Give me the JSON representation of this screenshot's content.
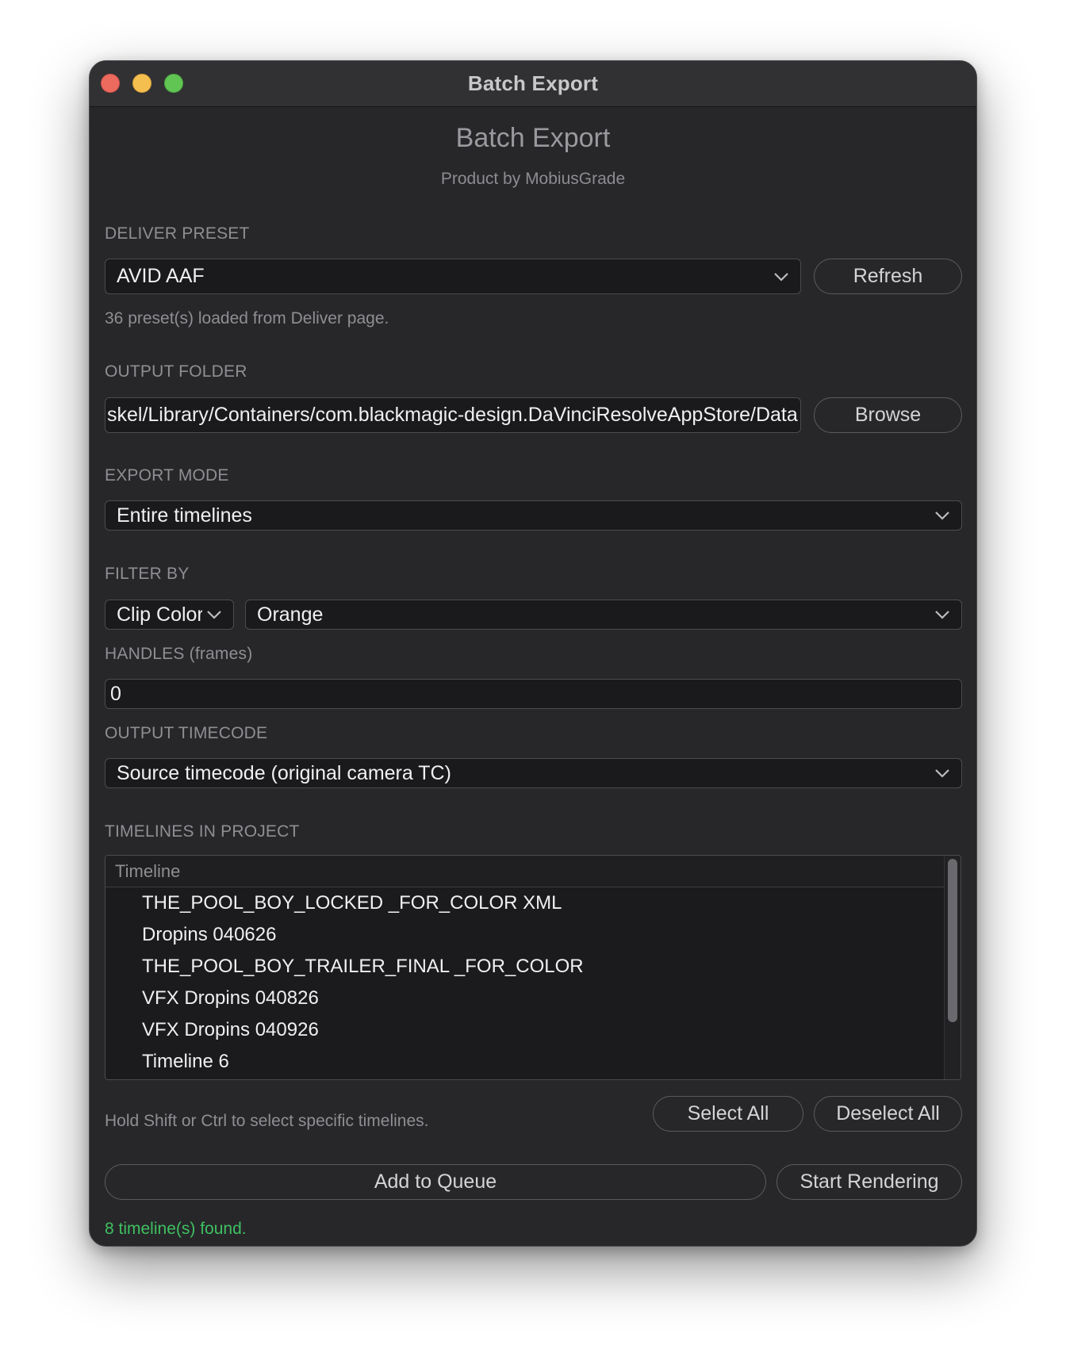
{
  "window": {
    "title": "Batch Export"
  },
  "header": {
    "title": "Batch Export",
    "subtitle": "Product by MobiusGrade"
  },
  "deliver_preset": {
    "label": "DELIVER PRESET",
    "selected": "AVID AAF",
    "refresh_label": "Refresh",
    "hint": "36 preset(s) loaded from Deliver page."
  },
  "output_folder": {
    "label": "OUTPUT FOLDER",
    "value": "skel/Library/Containers/com.blackmagic-design.DaVinciResolveAppStore/Data",
    "browse_label": "Browse"
  },
  "export_mode": {
    "label": "EXPORT MODE",
    "selected": "Entire timelines"
  },
  "filter_by": {
    "label": "FILTER BY",
    "field": "Clip Color",
    "value": "Orange"
  },
  "handles": {
    "label": "HANDLES (frames)",
    "value": "0"
  },
  "output_timecode": {
    "label": "OUTPUT TIMECODE",
    "selected": "Source timecode (original camera TC)"
  },
  "timelines": {
    "label": "TIMELINES IN PROJECT",
    "column_header": "Timeline",
    "items": [
      "THE_POOL_BOY_LOCKED _FOR_COLOR XML",
      "Dropins 040626",
      "THE_POOL_BOY_TRAILER_FINAL _FOR_COLOR",
      "VFX Dropins 040826",
      "VFX Dropins 040926",
      "Timeline 6"
    ],
    "hint": "Hold Shift or Ctrl to select specific timelines.",
    "select_all_label": "Select All",
    "deselect_all_label": "Deselect All"
  },
  "actions": {
    "add_to_queue_label": "Add to Queue",
    "start_rendering_label": "Start Rendering"
  },
  "status": {
    "text": "8 timeline(s) found.",
    "color": "#3fc060"
  },
  "colors": {
    "window_bg": "#27272a",
    "field_bg": "#1a1a1c",
    "close": "#ed6a5e",
    "minimize": "#f4bf4f",
    "maximize": "#61c554"
  }
}
